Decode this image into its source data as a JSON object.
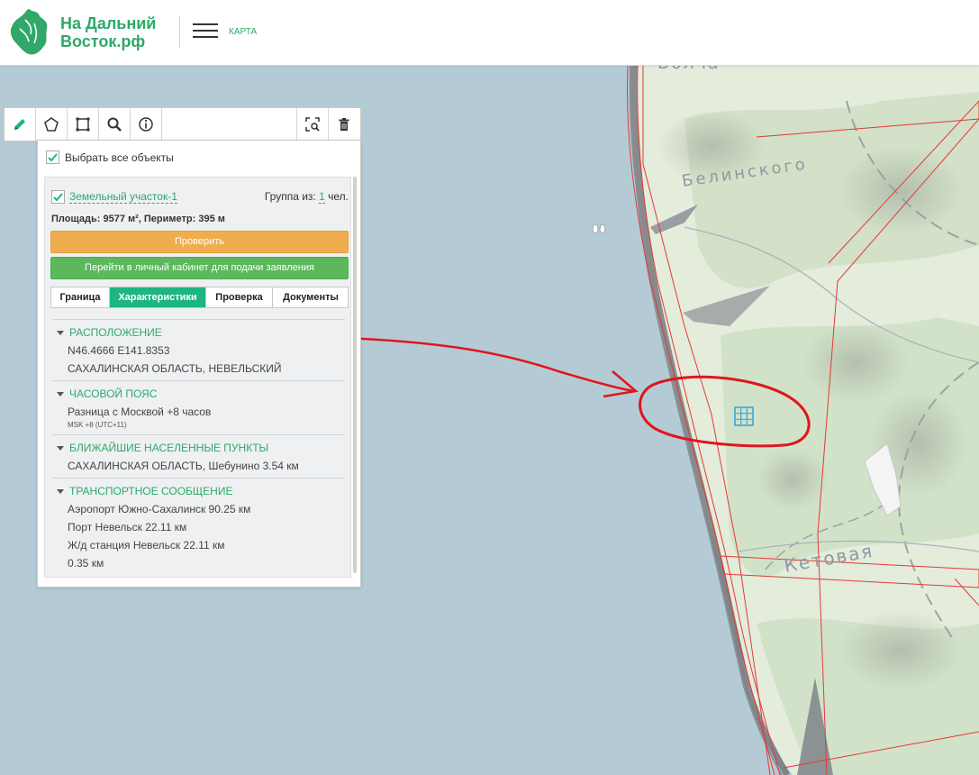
{
  "header": {
    "brand_line1": "На Дальний",
    "brand_line2": "Восток.рф",
    "menu_label": "КАРТА"
  },
  "toolbar": {
    "tools": [
      "pencil-icon",
      "polygon-icon",
      "rectangle-icon",
      "search-icon",
      "info-icon"
    ],
    "right_tools": [
      "zoom-to-selection-icon",
      "trash-icon"
    ]
  },
  "panel": {
    "select_all_label": "Выбрать все объекты",
    "parcel_name": "Земельный участок-1",
    "group_label": "Группа из:",
    "group_count": "1",
    "group_unit": "чел.",
    "area_text": "Площадь: 9577 м², Периметр: 395 м",
    "check_button": "Проверить",
    "apply_button": "Перейти в личный кабинет для подачи заявления",
    "tabs": [
      "Граница",
      "Характеристики",
      "Проверка",
      "Документы"
    ],
    "active_tab": "Характеристики",
    "sections": [
      {
        "title": "РАСПОЛОЖЕНИЕ",
        "lines": [
          "N46.4666 E141.8353",
          "САХАЛИНСКАЯ ОБЛАСТЬ, НЕВЕЛЬСКИЙ"
        ]
      },
      {
        "title": "ЧАСОВОЙ ПОЯС",
        "lines": [
          "Разница с Москвой +8 часов"
        ],
        "note": "MSK +8 (UTC+11)"
      },
      {
        "title": "БЛИЖАЙШИЕ НАСЕЛЕННЫЕ ПУНКТЫ",
        "lines": [
          "САХАЛИНСКАЯ ОБЛАСТЬ, Шебунино 3.54 км"
        ]
      },
      {
        "title": "ТРАНСПОРТНОЕ СООБЩЕНИЕ",
        "lines": [
          "Аэропорт Южно-Сахалинск 90.25 км",
          "Порт Невельск 22.11 км",
          "Ж/д станция Невельск 22.11 км",
          "0.35 км"
        ]
      }
    ]
  },
  "map": {
    "labels": {
      "top": "Волча",
      "river1": "Белинского",
      "river2": "Кетовая"
    },
    "colors": {
      "sea": "#b4cbd6",
      "land": "#e4ecdc",
      "boundary": "#e53935",
      "annotation": "#e0161c",
      "brand": "#2fa86a"
    }
  }
}
